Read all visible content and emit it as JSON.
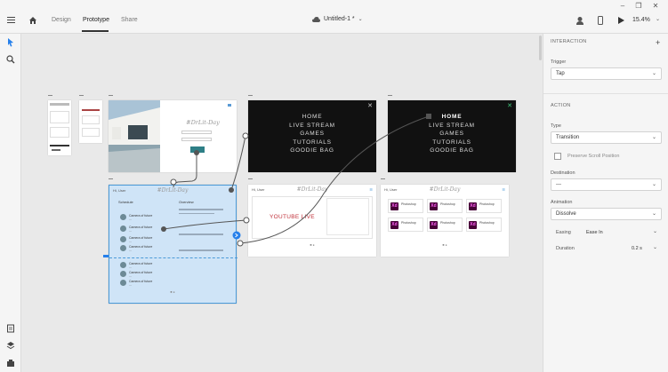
{
  "header": {
    "tabs": [
      {
        "label": "Design"
      },
      {
        "label": "Prototype"
      },
      {
        "label": "Share"
      }
    ],
    "doc_title": "Untitled-1 *",
    "zoom": "15.4%"
  },
  "canvas": {
    "dark_menu": {
      "items": [
        "HOME",
        "LIVE STREAM",
        "GAMES",
        "TUTORIALS",
        "GOODIE BAG"
      ]
    },
    "brand": "#DrLit-Day",
    "youtube_text": "YOUTUBE LIVE",
    "selected": {
      "schedule_title": "Schedule",
      "overview_title": "Overview",
      "rows": [
        "Camera of future",
        "Camera of future",
        "Camera of future",
        "Camera of future",
        "Camera of future",
        "Camera of future",
        "Camera of future"
      ]
    },
    "xd_cards": [
      {
        "icon": "Xd",
        "text": "Xd"
      },
      {
        "icon": "Xd",
        "text": "Xd"
      },
      {
        "icon": "Xd",
        "text": "Xd"
      },
      {
        "icon": "Xd",
        "text": "Xd"
      },
      {
        "icon": "Xd",
        "text": "Xd"
      },
      {
        "icon": "Xd",
        "text": "Xd"
      }
    ]
  },
  "panel": {
    "interaction_head": "INTERACTION",
    "trigger_label": "Trigger",
    "trigger_value": "Tap",
    "action_head": "ACTION",
    "type_label": "Type",
    "type_value": "Transition",
    "preserve_label": "Preserve Scroll Position",
    "destination_label": "Destination",
    "destination_value": "---",
    "animation_label": "Animation",
    "animation_value": "Dissolve",
    "easing_label": "Easing",
    "easing_value": "Ease In",
    "duration_label": "Duration",
    "duration_value": "0.2 s"
  },
  "colors": {
    "accent": "#4b9ad8",
    "xd_bg": "#470137",
    "xd_fg": "#ff61f6"
  }
}
